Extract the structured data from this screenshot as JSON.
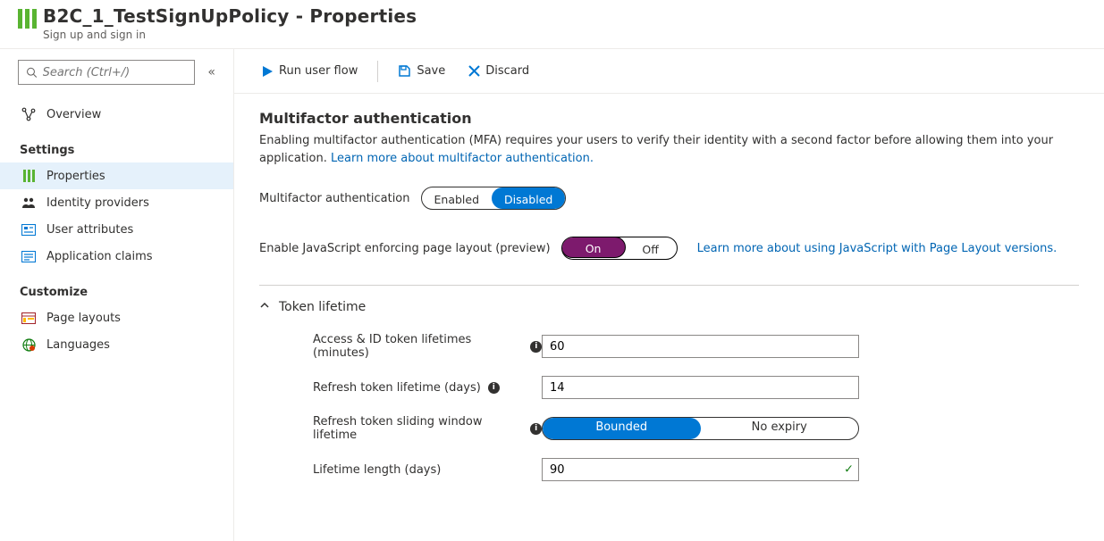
{
  "header": {
    "title": "B2C_1_TestSignUpPolicy - Properties",
    "subtitle": "Sign up and sign in"
  },
  "search": {
    "placeholder": "Search (Ctrl+/)"
  },
  "nav": {
    "overview": "Overview",
    "settings_header": "Settings",
    "properties": "Properties",
    "identity_providers": "Identity providers",
    "user_attributes": "User attributes",
    "application_claims": "Application claims",
    "customize_header": "Customize",
    "page_layouts": "Page layouts",
    "languages": "Languages"
  },
  "toolbar": {
    "run": "Run user flow",
    "save": "Save",
    "discard": "Discard"
  },
  "mfa": {
    "title": "Multifactor authentication",
    "desc_pre": "Enabling multifactor authentication (MFA) requires your users to verify their identity with a second factor before allowing them into your application. ",
    "learn_link": "Learn more about multifactor authentication.",
    "label": "Multifactor authentication",
    "enabled": "Enabled",
    "disabled": "Disabled"
  },
  "js": {
    "label": "Enable JavaScript enforcing page layout (preview)",
    "on": "On",
    "off": "Off",
    "learn": "Learn more about using JavaScript with Page Layout versions."
  },
  "token": {
    "title": "Token lifetime",
    "access_label": "Access & ID token lifetimes (minutes)",
    "access_value": "60",
    "refresh_label": "Refresh token lifetime (days)",
    "refresh_value": "14",
    "sliding_label": "Refresh token sliding window lifetime",
    "sliding_bounded": "Bounded",
    "sliding_noexpiry": "No expiry",
    "length_label": "Lifetime length (days)",
    "length_value": "90"
  }
}
